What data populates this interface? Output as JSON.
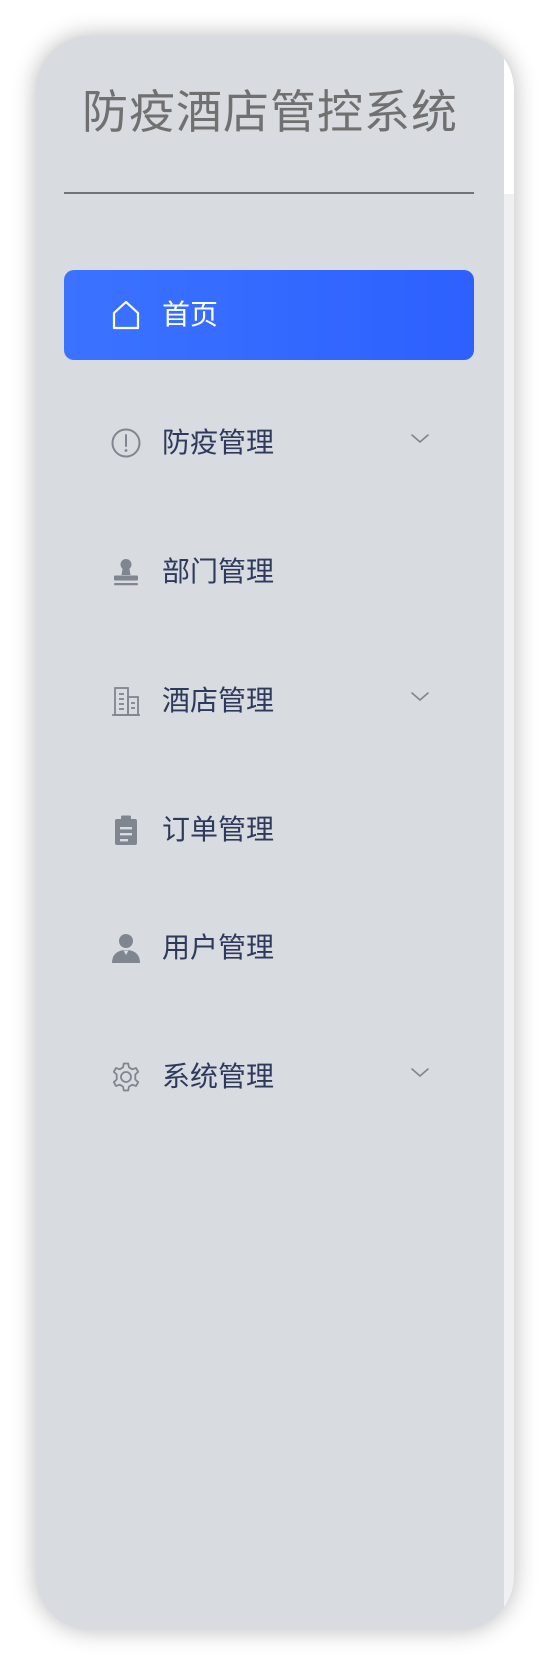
{
  "app": {
    "title": "防疫酒店管控系统"
  },
  "theme": {
    "sidebar_bg": "#d8dbdf",
    "active_bg": "#2d60ff",
    "label_color": "#2e3a5c",
    "icon_color": "#808690",
    "title_color": "#707070"
  },
  "menu": {
    "items": [
      {
        "label": "首页",
        "icon": "home-icon",
        "active": true,
        "has_submenu": false
      },
      {
        "label": "防疫管理",
        "icon": "exclamation-circle-icon",
        "active": false,
        "has_submenu": true
      },
      {
        "label": "部门管理",
        "icon": "stamp-icon",
        "active": false,
        "has_submenu": false
      },
      {
        "label": "酒店管理",
        "icon": "building-icon",
        "active": false,
        "has_submenu": true
      },
      {
        "label": "订单管理",
        "icon": "clipboard-icon",
        "active": false,
        "has_submenu": false
      },
      {
        "label": "用户管理",
        "icon": "user-icon",
        "active": false,
        "has_submenu": false
      },
      {
        "label": "系统管理",
        "icon": "gear-icon",
        "active": false,
        "has_submenu": true
      }
    ]
  }
}
